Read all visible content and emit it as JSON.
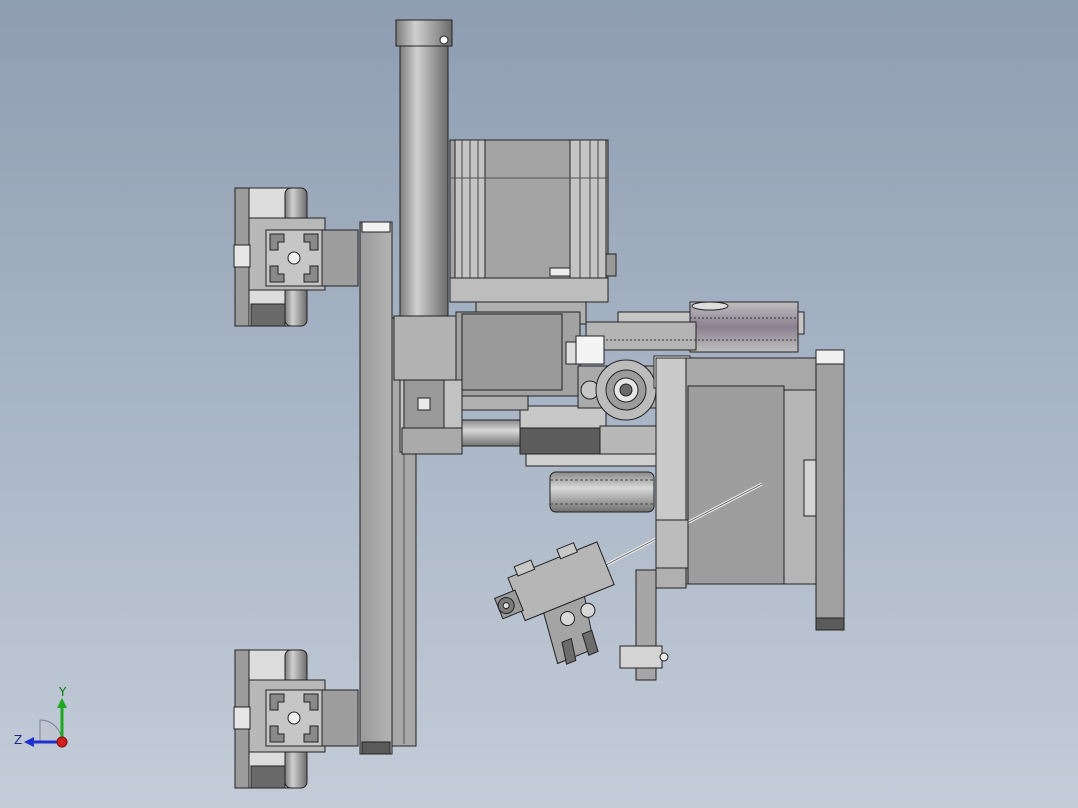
{
  "view": {
    "background_top": "#8e9db1",
    "background_bottom": "#c4ccd8",
    "model_stroke": "#222222",
    "model_fill_light": "#c8c8c8",
    "model_fill_mid": "#a0a0a0",
    "model_fill_dark": "#6a6a6a"
  },
  "triad": {
    "y_label": "Y",
    "z_label": "Z",
    "y_color": "#1fa81f",
    "z_color": "#1f2fd0",
    "origin_color": "#d01f1f"
  }
}
